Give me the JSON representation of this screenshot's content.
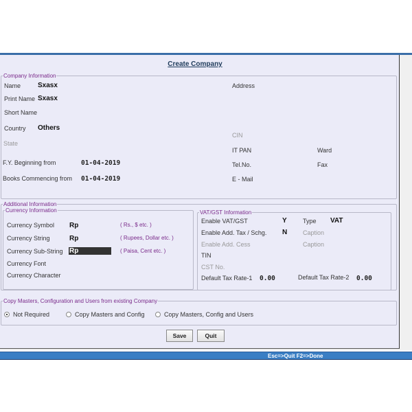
{
  "title": "Create Company",
  "company_info": {
    "legend": "Company Information",
    "name_label": "Name",
    "name_value": "Sxasx",
    "print_name_label": "Print Name",
    "print_name_value": "Sxasx",
    "short_name_label": "Short Name",
    "country_label": "Country",
    "country_value": "Others",
    "state_label": "State",
    "fy_label": "F.Y.  Beginning from",
    "fy_value": "01-04-2019",
    "books_label": "Books Commencing from",
    "books_value": "01-04-2019",
    "address_label": "Address",
    "cin_label": "CIN",
    "itpan_label": "IT PAN",
    "ward_label": "Ward",
    "tel_label": "Tel.No.",
    "fax_label": "Fax",
    "email_label": "E - Mail"
  },
  "additional": {
    "legend": "Additional Information",
    "currency": {
      "legend": "Currency Information",
      "symbol_label": "Currency Symbol",
      "symbol_value": "Rp",
      "symbol_hint": "( Rs., $ etc. )",
      "string_label": "Currency String",
      "string_value": "Rp",
      "string_hint": "( Rupees, Dollar etc. )",
      "sub_label": "Currency Sub-String",
      "sub_value": "Rp",
      "sub_hint": "( Paisa, Cent etc. )",
      "font_label": "Currency Font",
      "char_label": "Currency Character"
    },
    "vat": {
      "legend": "VAT/GST Information",
      "enable_label": "Enable VAT/GST",
      "enable_value": "Y",
      "type_label": "Type",
      "type_value": "VAT",
      "addtax_label": "Enable Add. Tax / Schg.",
      "addtax_value": "N",
      "caption1": "Caption",
      "cess_label": "Enable Add. Cess",
      "caption2": "Caption",
      "tin_label": "TIN",
      "cst_label": "CST No.",
      "rate1_label": "Default Tax Rate-1",
      "rate1_value": "0.00",
      "rate2_label": "Default Tax Rate-2",
      "rate2_value": "0.00"
    }
  },
  "copy": {
    "legend": "Copy Masters, Configuration and Users from existing Company",
    "options": [
      "Not Required",
      "Copy Masters and Config",
      "Copy Masters, Config and Users"
    ],
    "selected": "Not Required"
  },
  "buttons": {
    "save": "Save",
    "quit": "Quit"
  },
  "status": "Esc=>Quit   F2=>Done"
}
